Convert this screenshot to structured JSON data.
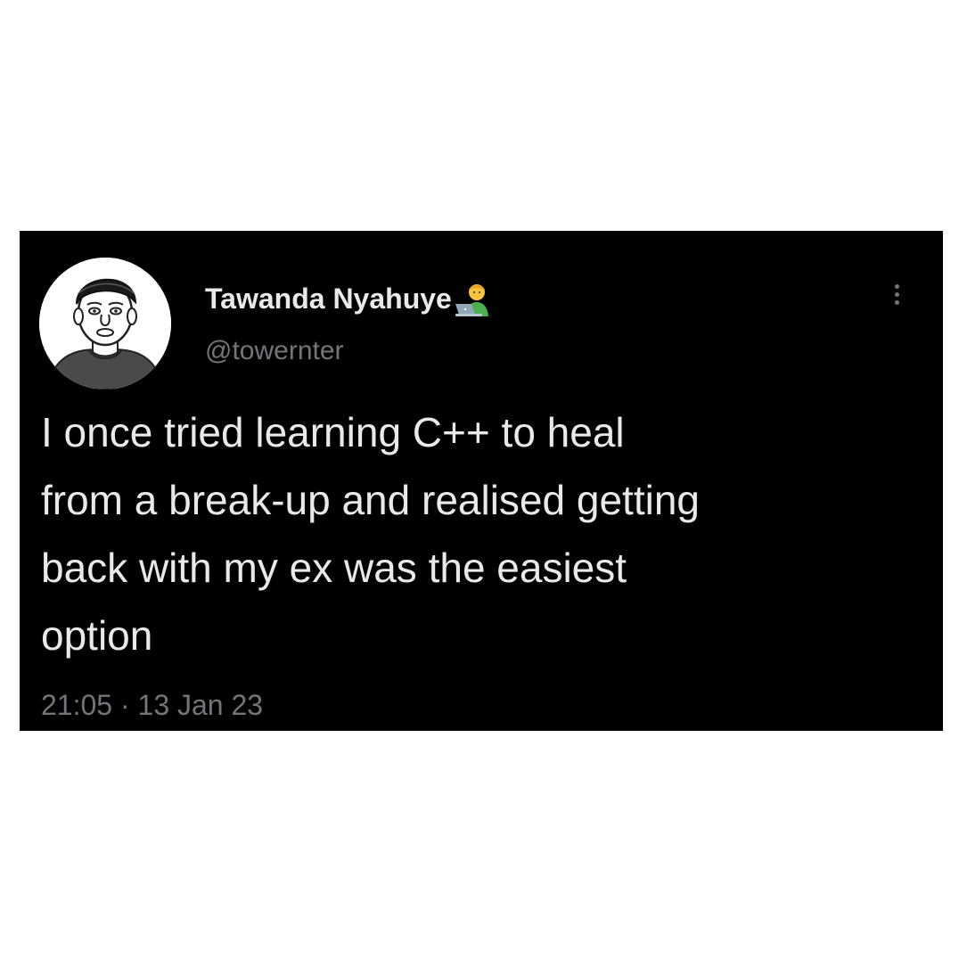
{
  "tweet": {
    "author_name": "Tawanda Nyahuye",
    "author_emoji_icon": "man-technologist-icon",
    "handle": "@towernter",
    "text_lines": [
      "I once tried learning C++ to heal",
      "from a break-up and realised getting",
      "back with my ex was the easiest",
      "option"
    ],
    "time": "21:05",
    "separator": "·",
    "date": "13 Jan 23",
    "more_icon": "more-vertical-icon"
  },
  "colors": {
    "card_background": "#000000",
    "page_background": "#ffffff",
    "primary_text": "#e7e9ea",
    "secondary_text": "#71767b"
  }
}
